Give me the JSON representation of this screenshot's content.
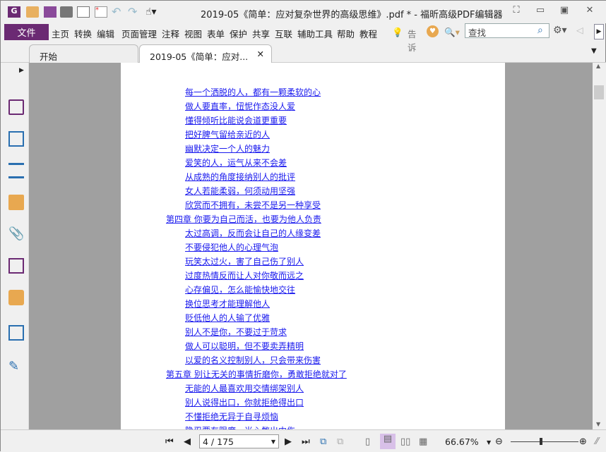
{
  "window": {
    "title": "2019-05《简单：应对复杂世界的高级思维》.pdf * - 福昕高级PDF编辑器"
  },
  "menu": {
    "file": "文件",
    "items": [
      "主页",
      "转换",
      "编辑",
      "页面管理",
      "注释",
      "视图",
      "表单",
      "保护",
      "共享",
      "互联",
      "辅助工具",
      "帮助",
      "教程"
    ],
    "tell": "告诉",
    "search_placeholder": "查找"
  },
  "tabs": [
    {
      "label": "开始"
    },
    {
      "label": "2019-05《简单：应对..."
    }
  ],
  "document": {
    "lines": [
      {
        "text": "每一个洒脱的人，都有一颗柔软的心",
        "level": 2
      },
      {
        "text": "做人要直率，忸怩作态没人爱",
        "level": 2
      },
      {
        "text": "懂得倾听比能说会道更重要",
        "level": 2
      },
      {
        "text": "把好脾气留给亲近的人",
        "level": 2
      },
      {
        "text": "幽默决定一个人的魅力",
        "level": 2
      },
      {
        "text": "爱笑的人，运气从来不会差",
        "level": 2
      },
      {
        "text": "从成熟的角度接纳别人的批评",
        "level": 2
      },
      {
        "text": "女人若能柔弱，何须动用坚强",
        "level": 2
      },
      {
        "text": "欣赏而不拥有，未尝不是另一种享受",
        "level": 2
      },
      {
        "text": "第四章 你要为自己而活，也要为他人负责",
        "level": 1
      },
      {
        "text": "太过高调，反而会让自己的人缘变差",
        "level": 2
      },
      {
        "text": "不要侵犯他人的心理气泡",
        "level": 2
      },
      {
        "text": "玩笑太过火，害了自己伤了别人",
        "level": 2
      },
      {
        "text": "过度热情反而让人对你敬而远之",
        "level": 2
      },
      {
        "text": "心存偏见，怎么能愉快地交往",
        "level": 2
      },
      {
        "text": "换位思考才能理解他人",
        "level": 2
      },
      {
        "text": "贬低他人的人输了优雅",
        "level": 2
      },
      {
        "text": "别人不是你，不要过于苛求",
        "level": 2
      },
      {
        "text": "做人可以聪明，但不要卖弄精明",
        "level": 2
      },
      {
        "text": "以爱的名义控制别人，只会带来伤害",
        "level": 2
      },
      {
        "text": "第五章 别让无关的事情折磨你，勇敢拒绝就对了",
        "level": 1
      },
      {
        "text": "无能的人最喜欢用交情绑架别人",
        "level": 2
      },
      {
        "text": "别人说得出口，你就拒绝得出口",
        "level": 2
      },
      {
        "text": "不懂拒绝无异于自寻烦恼",
        "level": 2
      },
      {
        "text": "隐忍要有限度，当心憋出内伤",
        "level": 2
      }
    ]
  },
  "status": {
    "page": "4 / 175",
    "zoom": "66.67%",
    "zoom_slider": 0.45
  },
  "colors": {
    "accent": "#6b2a73",
    "link": "#1a1aee"
  }
}
